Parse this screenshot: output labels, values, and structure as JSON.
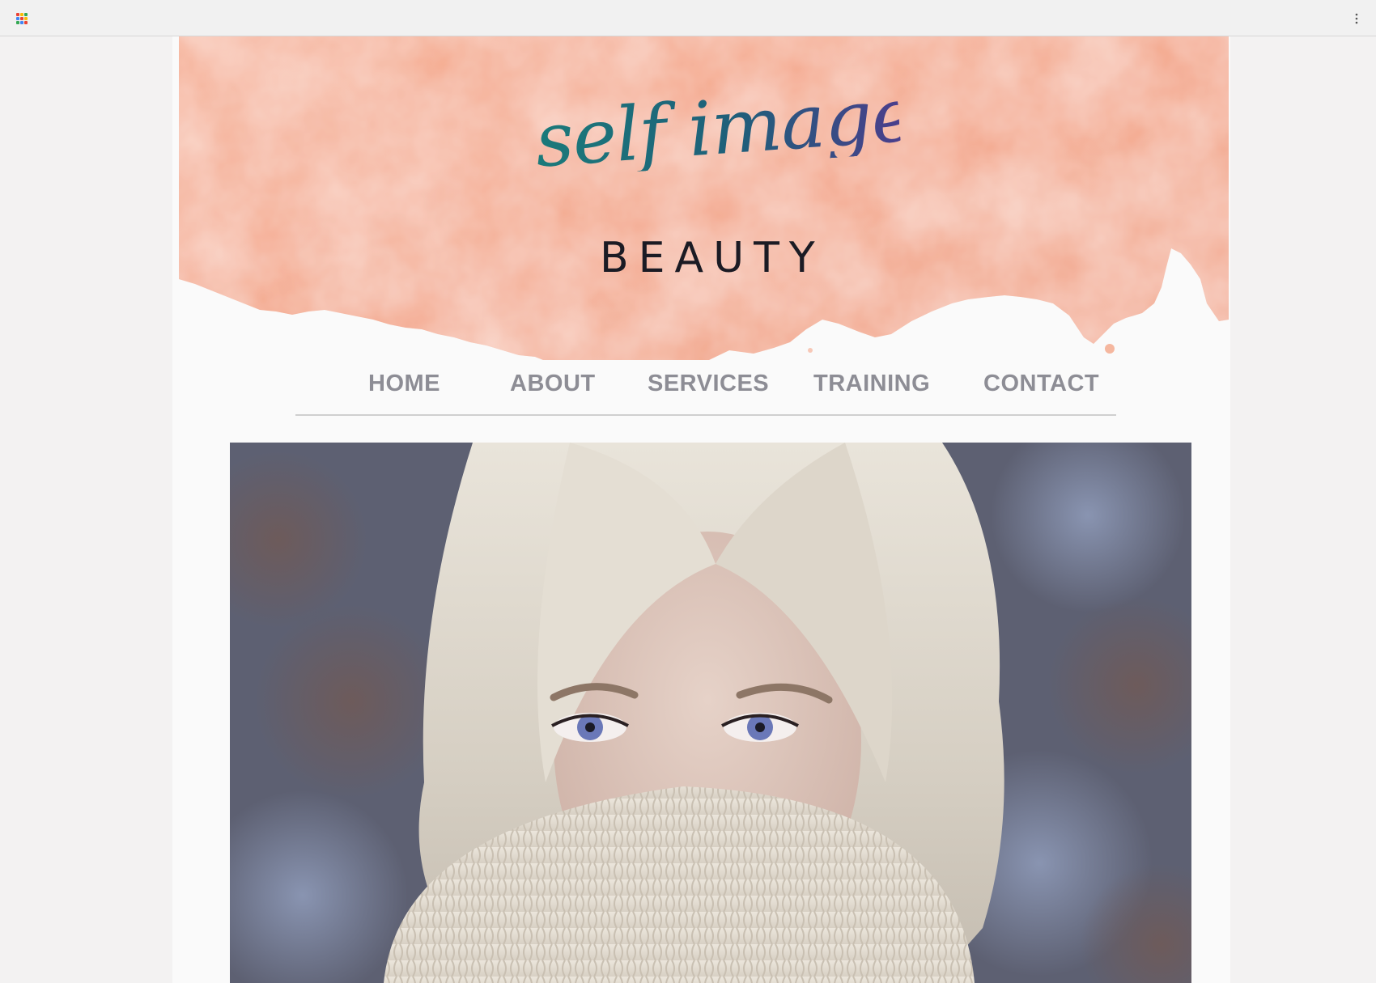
{
  "browser": {
    "apps_icon": "apps-grid-icon",
    "menu_icon": "kebab-menu-icon"
  },
  "brand": {
    "script_text": "self image",
    "sub_text": "BEAUTY",
    "colors": {
      "watercolor": "#f4a688",
      "script_teal": "#1a7a7a",
      "script_violet": "#4a3f8c",
      "nav_text": "#8d8d95"
    }
  },
  "nav": {
    "items": [
      {
        "label": "HOME"
      },
      {
        "label": "ABOUT"
      },
      {
        "label": "SERVICES"
      },
      {
        "label": "TRAINING"
      },
      {
        "label": "CONTACT"
      }
    ]
  },
  "hero": {
    "subject": "photo"
  }
}
